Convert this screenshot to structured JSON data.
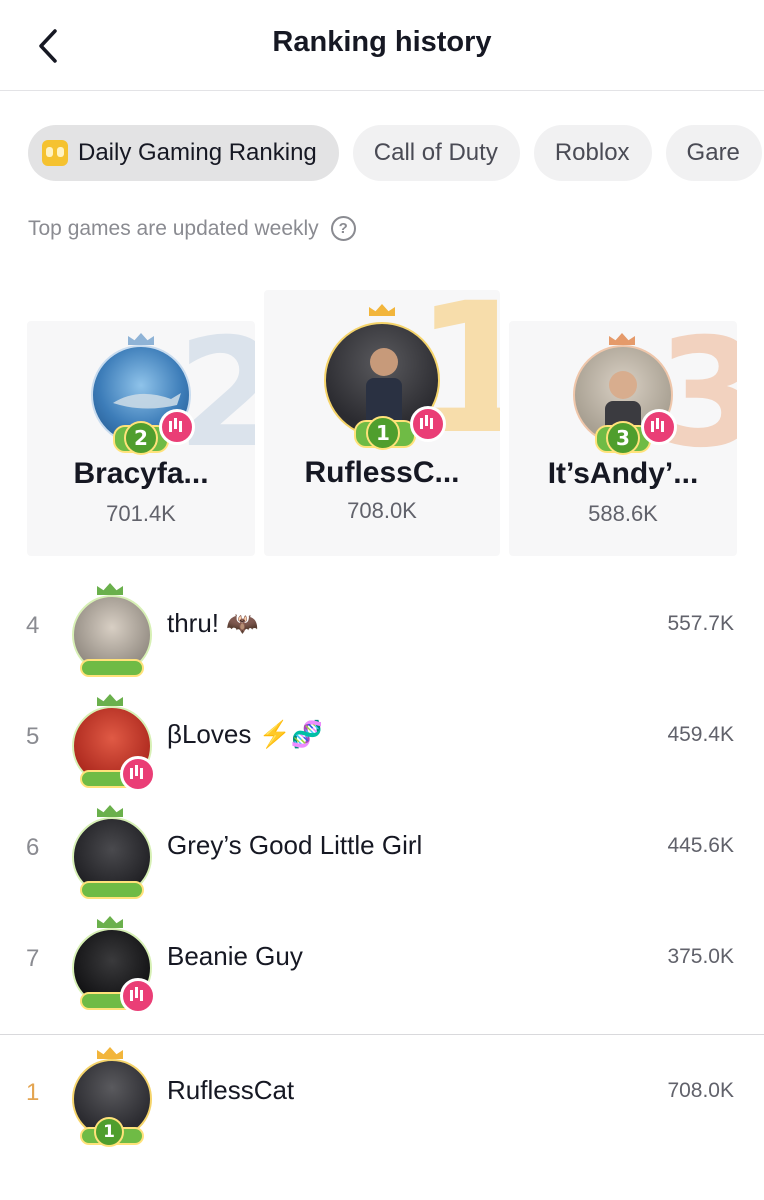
{
  "header": {
    "title": "Ranking history"
  },
  "tabs": [
    {
      "label": "Daily Gaming Ranking",
      "active": true
    },
    {
      "label": "Call of Duty",
      "active": false
    },
    {
      "label": "Roblox",
      "active": false
    },
    {
      "label": "Gare",
      "active": false
    }
  ],
  "subtitle": "Top games are updated weekly",
  "podium": [
    {
      "rank": "2",
      "name": "Bracyfa...",
      "score": "701.4K"
    },
    {
      "rank": "1",
      "name": "RuflessC...",
      "score": "708.0K"
    },
    {
      "rank": "3",
      "name": "It’sAndy’...",
      "score": "588.6K"
    }
  ],
  "list": [
    {
      "rank": "4",
      "name": "thru! 🦇",
      "score": "557.7K"
    },
    {
      "rank": "5",
      "name": "βLoves ⚡️🧬",
      "score": "459.4K"
    },
    {
      "rank": "6",
      "name": "Grey’s Good Little Girl",
      "score": "445.6K"
    },
    {
      "rank": "7",
      "name": "Beanie Guy",
      "score": "375.0K"
    }
  ],
  "my_rank": {
    "rank": "1",
    "name": "RuflessCat",
    "score": "708.0K"
  },
  "colors": {
    "gold": "#f2c14e",
    "silver": "#8fb3d6",
    "bronze": "#e59a6a",
    "live": "#ea3e76",
    "badge_green": "#6fbb45"
  }
}
